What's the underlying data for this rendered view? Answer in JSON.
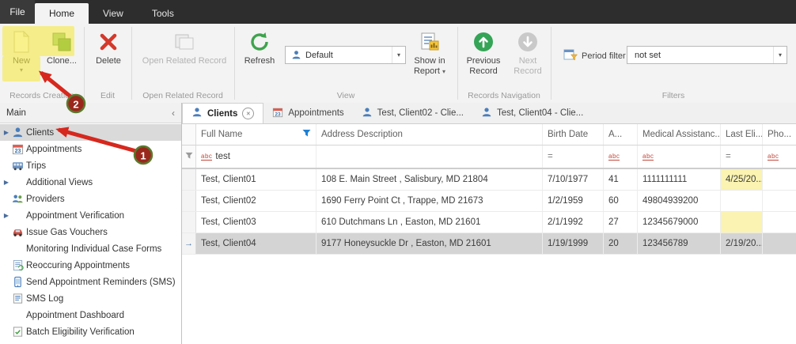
{
  "menubar": {
    "file": "File",
    "tabs": [
      {
        "label": "Home"
      },
      {
        "label": "View"
      },
      {
        "label": "Tools"
      }
    ]
  },
  "ribbon": {
    "buttons": {
      "new": "New",
      "clone": "Clone...",
      "delete": "Delete",
      "open_related": "Open Related Record",
      "refresh": "Refresh",
      "show_in_report": "Show in Report",
      "previous": "Previous Record",
      "next": "Next Record"
    },
    "view_selector": {
      "value": "Default"
    },
    "period_filter": {
      "label": "Period filter",
      "value": "not set"
    },
    "groups": {
      "records_creation": "Records Creation",
      "edit": "Edit",
      "open_related": "Open Related Record",
      "view": "View",
      "records_navigation": "Records Navigation",
      "filters": "Filters"
    }
  },
  "sidebar": {
    "title": "Main",
    "items": [
      {
        "label": "Clients"
      },
      {
        "label": "Appointments"
      },
      {
        "label": "Trips"
      },
      {
        "label": "Additional Views"
      },
      {
        "label": "Providers"
      },
      {
        "label": "Appointment Verification"
      },
      {
        "label": "Issue Gas Vouchers"
      },
      {
        "label": "Monitoring Individual Case Forms"
      },
      {
        "label": "Reoccuring Appointments"
      },
      {
        "label": "Send Appointment Reminders (SMS)"
      },
      {
        "label": "SMS Log"
      },
      {
        "label": "Appointment Dashboard"
      },
      {
        "label": "Batch Eligibility Verification"
      }
    ]
  },
  "tabs": [
    {
      "label": "Clients"
    },
    {
      "label": "Appointments"
    },
    {
      "label": "Test, Client02 - Clie..."
    },
    {
      "label": "Test, Client04 - Clie..."
    }
  ],
  "grid": {
    "columns": [
      "Full Name",
      "Address Description",
      "Birth Date",
      "A...",
      "Medical Assistanc...",
      "Last Eli...",
      "Pho..."
    ],
    "filter": {
      "full_name": "test",
      "birth_date_op": "=",
      "last_eli_op": "="
    },
    "rows": [
      {
        "full_name": "Test, Client01",
        "address": "108 E. Main Street , Salisbury, MD 21804",
        "birth_date": "7/10/1977",
        "age": "41",
        "medical": "1111111111",
        "last_eli": "4/25/20...",
        "phone": ""
      },
      {
        "full_name": "Test, Client02",
        "address": "1690 Ferry Point Ct , Trappe, MD 21673",
        "birth_date": "1/2/1959",
        "age": "60",
        "medical": "49804939200",
        "last_eli": "",
        "phone": ""
      },
      {
        "full_name": "Test, Client03",
        "address": "610 Dutchmans Ln , Easton, MD 21601",
        "birth_date": "2/1/1992",
        "age": "27",
        "medical": "12345679000",
        "last_eli": "",
        "phone": ""
      },
      {
        "full_name": "Test, Client04",
        "address": "9177 Honeysuckle Dr , Easton, MD 21601",
        "birth_date": "1/19/1999",
        "age": "20",
        "medical": "123456789",
        "last_eli": "2/19/20...",
        "phone": ""
      }
    ]
  },
  "icons": {
    "appointments_badge": "23"
  },
  "annotations": {
    "step1": "1",
    "step2": "2"
  },
  "colors": {
    "accent_green": "#35a456",
    "annotation_red": "#d6281e",
    "highlight_yellow": "#f7e944",
    "cell_yellow": "#faf3b1"
  }
}
